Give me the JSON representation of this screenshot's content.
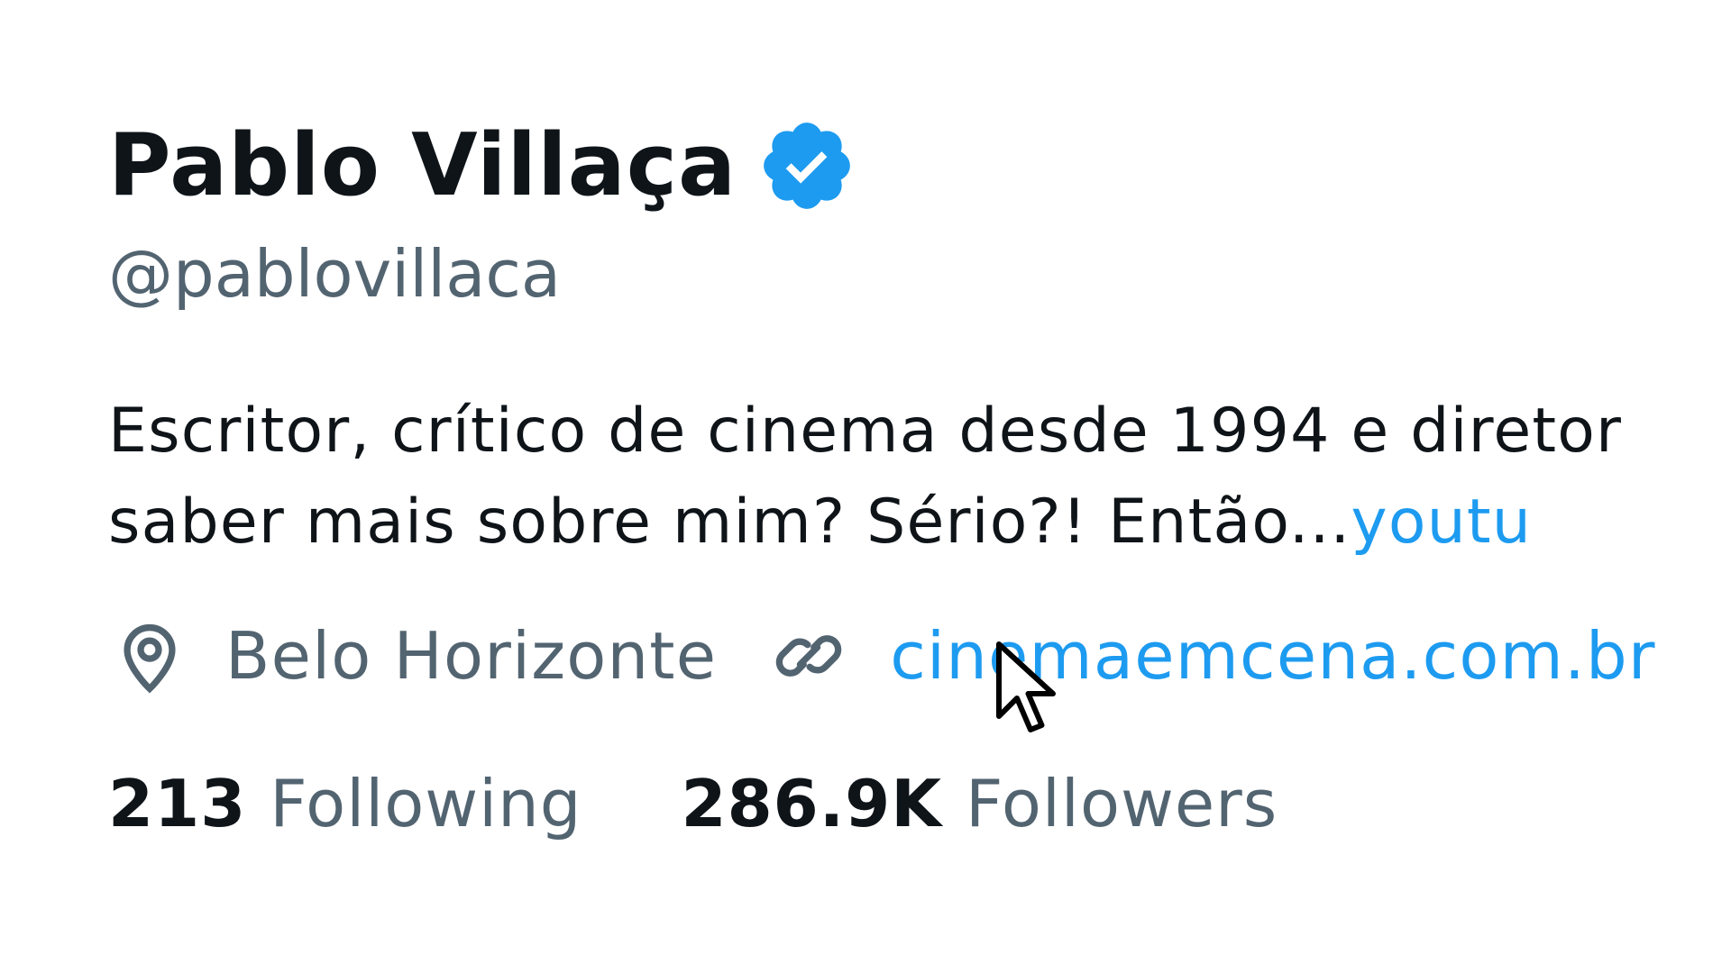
{
  "profile": {
    "display_name": "Pablo Villaça",
    "handle": "@pablovillaca",
    "verified": true,
    "badge_icon": "verified-badge-icon",
    "bio_line1": "Escritor, crítico de cinema desde 1994 e diretor",
    "bio_line2_text": "saber mais sobre mim? Sério?!  Então...",
    "bio_line2_link": "youtu",
    "location": "Belo Horizonte",
    "location_icon": "location-pin-icon",
    "website": "cinemaemcena.com.br",
    "website_icon": "link-icon"
  },
  "stats": {
    "following_count": "213",
    "following_label": "Following",
    "followers_count": "286.9K",
    "followers_label": "Followers"
  },
  "colors": {
    "text_primary": "#0f1419",
    "text_secondary": "#536471",
    "accent": "#1d9bf0"
  }
}
